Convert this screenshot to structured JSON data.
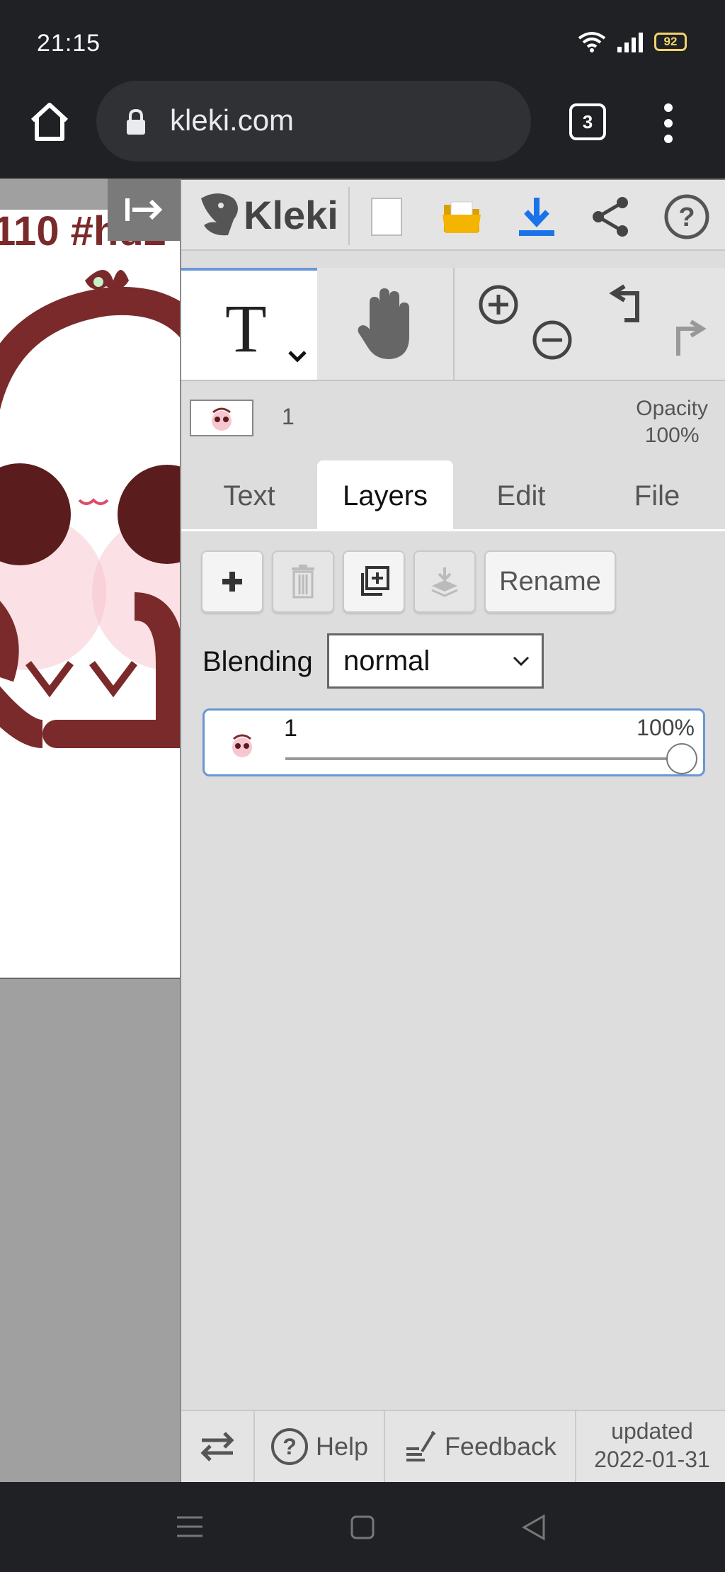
{
  "status_bar": {
    "time": "21:15",
    "battery": "92"
  },
  "browser": {
    "url": "kleki.com",
    "tab_count": "3"
  },
  "canvas": {
    "visible_text": "110 #hd2"
  },
  "app": {
    "logo_text": "Kleki",
    "layer_info": {
      "name": "1",
      "opacity_label": "Opacity",
      "opacity_value": "100%"
    },
    "tabs": [
      {
        "label": "Text"
      },
      {
        "label": "Layers",
        "active": true
      },
      {
        "label": "Edit"
      },
      {
        "label": "File"
      }
    ],
    "layers_panel": {
      "rename_label": "Rename",
      "blending_label": "Blending",
      "blending_value": "normal",
      "layers": [
        {
          "name": "1",
          "opacity": "100%",
          "opacity_fraction": 1.0
        }
      ]
    },
    "bottom": {
      "help_label": "Help",
      "feedback_label": "Feedback",
      "updated_label": "updated",
      "updated_date": "2022-01-31"
    }
  },
  "colors": {
    "accent": "#6b96d6",
    "download_blue": "#1a73e8",
    "folder_yellow": "#f5b400",
    "art_red": "#7a2a2a"
  }
}
